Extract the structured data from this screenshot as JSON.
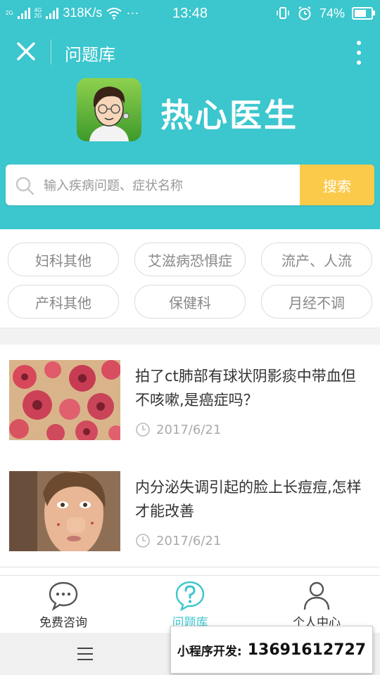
{
  "status_bar": {
    "net_top": "2G",
    "net_mid": "4G",
    "net_bottom": "2G",
    "speed": "318K/s",
    "dots": "···",
    "time": "13:48",
    "battery": "74%",
    "battery_level": 0.74
  },
  "nav": {
    "title": "问题库"
  },
  "brand": {
    "name": "热心医生"
  },
  "search": {
    "placeholder": "输入疾病问题、症状名称",
    "button": "搜索"
  },
  "tags": [
    "妇科其他",
    "艾滋病恐惧症",
    "流产、人流",
    "产科其他",
    "保健科",
    "月经不调"
  ],
  "articles": [
    {
      "title": "拍了ct肺部有球状阴影痰中带血但不咳嗽,是癌症吗？",
      "date": "2017/6/21"
    },
    {
      "title": "内分泌失调引起的脸上长痘痘,怎样才能改善",
      "date": "2017/6/21"
    }
  ],
  "tabbar": [
    {
      "label": "免费咨询",
      "icon": "chat-bubble-icon"
    },
    {
      "label": "问题库",
      "icon": "question-icon"
    },
    {
      "label": "个人中心",
      "icon": "person-icon"
    }
  ],
  "promo": {
    "label": "小程序开发:",
    "phone": "13691612727"
  },
  "colors": {
    "primary": "#3cc6ce",
    "search_button": "#fcca4b"
  }
}
